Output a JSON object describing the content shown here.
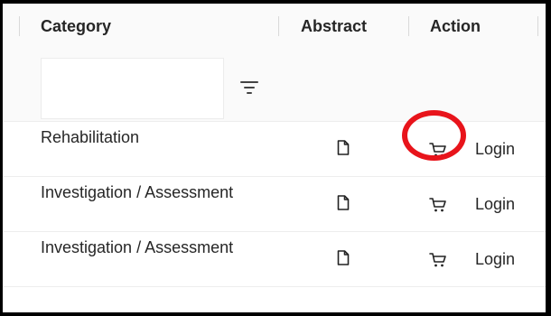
{
  "table": {
    "columns": [
      "Category",
      "Abstract",
      "Action"
    ],
    "filter": {
      "value": "",
      "icon": "filter-icon"
    },
    "rows": [
      {
        "category": "Rehabilitation",
        "abstract_icon": "document-icon",
        "cart_icon": "cart-icon",
        "action_label": "Login"
      },
      {
        "category": "Investigation / Assessment",
        "abstract_icon": "document-icon",
        "cart_icon": "cart-icon",
        "action_label": "Login"
      },
      {
        "category": "Investigation / Assessment",
        "abstract_icon": "document-icon",
        "cart_icon": "cart-icon",
        "action_label": "Login"
      }
    ]
  },
  "annotation": {
    "color": "#e8141b",
    "target": "cart-icon"
  },
  "colors": {
    "header_bg": "#fafafa",
    "border": "#ededed",
    "text": "#262626"
  }
}
